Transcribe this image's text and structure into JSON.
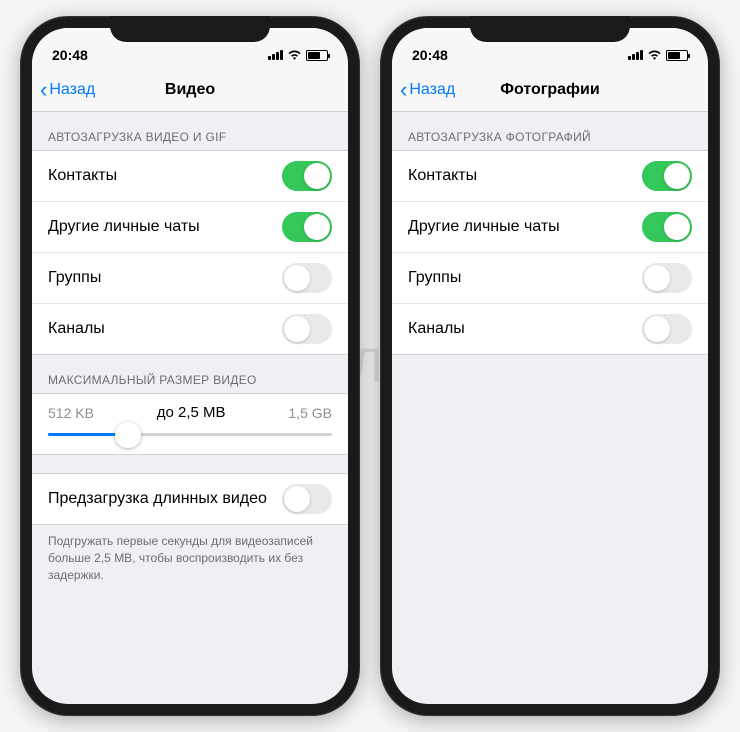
{
  "status": {
    "time": "20:48"
  },
  "left_phone": {
    "back_label": "Назад",
    "title": "Видео",
    "section1_header": "АВТОЗАГРУЗКА ВИДЕО И GIF",
    "rows": [
      {
        "label": "Контакты",
        "on": true
      },
      {
        "label": "Другие личные чаты",
        "on": true
      },
      {
        "label": "Группы",
        "on": false
      },
      {
        "label": "Каналы",
        "on": false
      }
    ],
    "section2_header": "МАКСИМАЛЬНЫЙ РАЗМЕР ВИДЕО",
    "slider": {
      "min": "512 KB",
      "current": "до 2,5 MB",
      "max": "1,5 GB"
    },
    "preload_row": {
      "label": "Предзагрузка длинных видео",
      "on": false
    },
    "footer": "Подгружать первые секунды для видеозаписей больше 2,5 MB, чтобы воспроизводить их без задержки."
  },
  "right_phone": {
    "back_label": "Назад",
    "title": "Фотографии",
    "section1_header": "АВТОЗАГРУЗКА ФОТОГРАФИЙ",
    "rows": [
      {
        "label": "Контакты",
        "on": true
      },
      {
        "label": "Другие личные чаты",
        "on": true
      },
      {
        "label": "Группы",
        "on": false
      },
      {
        "label": "Каналы",
        "on": false
      }
    ]
  },
  "watermark": "ЯБЛЫК"
}
